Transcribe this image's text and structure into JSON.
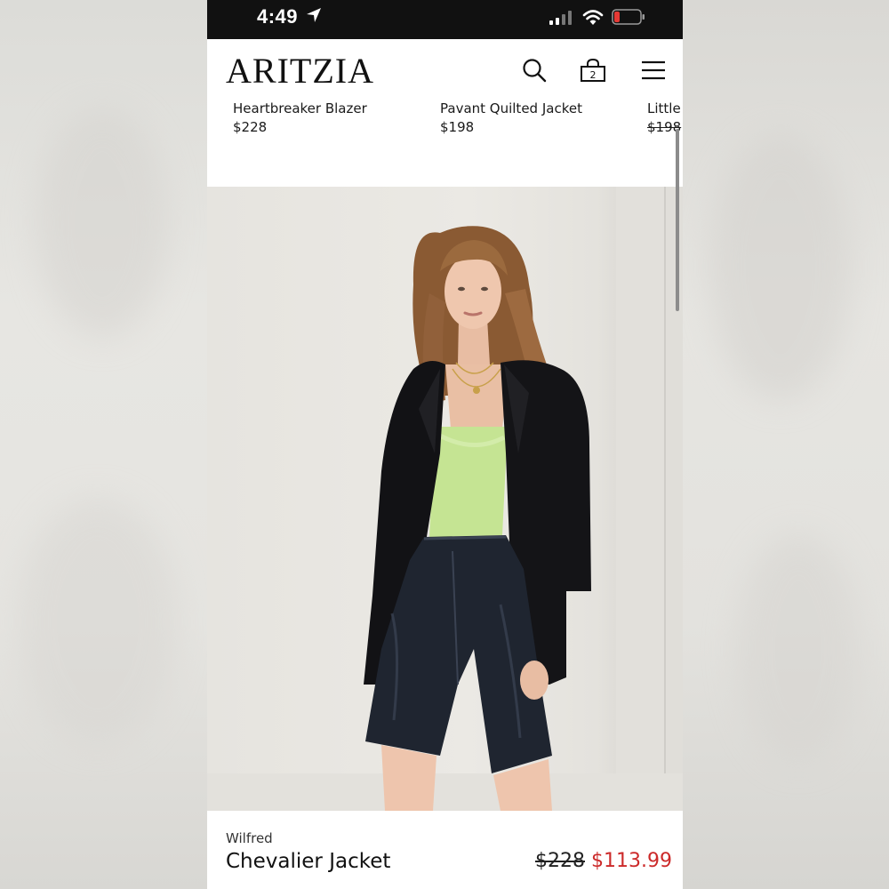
{
  "status_bar": {
    "time": "4:49",
    "battery_color": "#e53935"
  },
  "header": {
    "logo": "ARITZIA",
    "cart_count": "2",
    "icons": [
      "search-icon",
      "shopping-bag-icon",
      "menu-icon"
    ]
  },
  "carousel": {
    "items": [
      {
        "name": "Heartbreaker Blazer",
        "price": "$228",
        "struck": false
      },
      {
        "name": "Pavant Quilted Jacket",
        "price": "$198",
        "struck": false
      },
      {
        "name": "Little",
        "price": "$198",
        "struck": true
      }
    ]
  },
  "product": {
    "brand": "Wilfred",
    "name": "Chevalier Jacket",
    "original_price": "$228",
    "sale_price": "$113.99",
    "sale_color": "#cc2a2a"
  }
}
